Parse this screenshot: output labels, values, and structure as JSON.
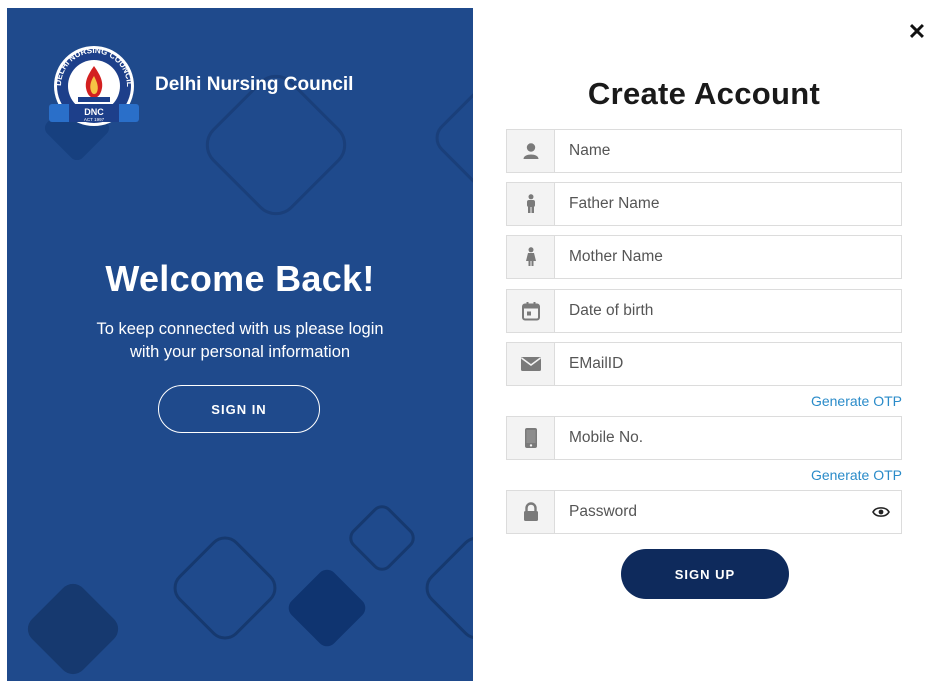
{
  "brand": {
    "org_name": "Delhi Nursing Council",
    "logo_top_text": "DELHI NURSING COUNCIL",
    "logo_badge": "DNC",
    "logo_act": "ACT 1997"
  },
  "welcome": {
    "title": "Welcome Back!",
    "text_line1": "To keep connected with us please login",
    "text_line2": "with your personal information",
    "signin_label": "SIGN IN"
  },
  "close_label": "✕",
  "form": {
    "title": "Create Account",
    "fields": [
      {
        "placeholder": "Name",
        "icon": "user-icon"
      },
      {
        "placeholder": "Father Name",
        "icon": "male-icon"
      },
      {
        "placeholder": "Mother Name",
        "icon": "female-icon"
      },
      {
        "placeholder": "Date of birth",
        "icon": "calendar-icon"
      },
      {
        "placeholder": "EMailID",
        "icon": "envelope-icon"
      },
      {
        "placeholder": "Mobile No.",
        "icon": "mobile-icon"
      },
      {
        "placeholder": "Password",
        "icon": "lock-icon"
      }
    ],
    "otp_email_label": "Generate OTP",
    "otp_mobile_label": "Generate OTP",
    "signup_label": "SIGN UP"
  },
  "colors": {
    "panel_bg": "#1f4a8c",
    "signup_bg": "#0e2a5c",
    "link": "#2a8bc9"
  }
}
